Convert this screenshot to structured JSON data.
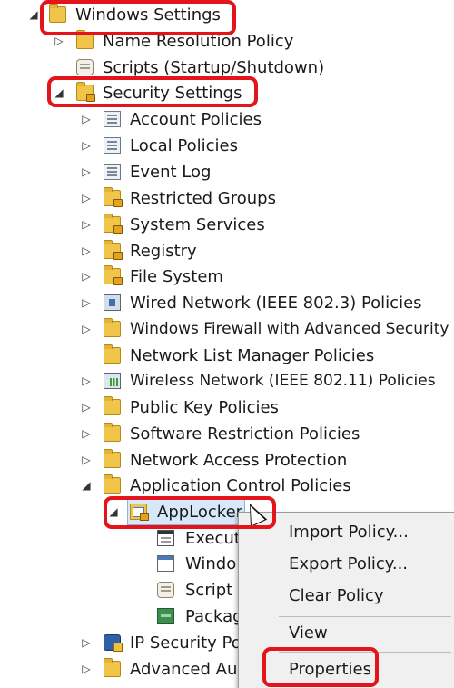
{
  "tree": [
    {
      "label": "Windows Settings",
      "expander": "◢",
      "icon": "folder-icon"
    },
    {
      "label": "Name Resolution Policy",
      "expander": "▷",
      "icon": "folder-icon"
    },
    {
      "label": "Scripts (Startup/Shutdown)",
      "expander": "",
      "icon": "scripts-icon"
    },
    {
      "label": "Security Settings",
      "expander": "◢",
      "icon": "security-settings-icon"
    },
    {
      "label": "Account Policies",
      "expander": "▷",
      "icon": "account-policies-icon"
    },
    {
      "label": "Local Policies",
      "expander": "▷",
      "icon": "local-policies-icon"
    },
    {
      "label": "Event Log",
      "expander": "▷",
      "icon": "event-log-icon"
    },
    {
      "label": "Restricted Groups",
      "expander": "▷",
      "icon": "locked-folder-icon"
    },
    {
      "label": "System Services",
      "expander": "▷",
      "icon": "locked-folder-icon"
    },
    {
      "label": "Registry",
      "expander": "▷",
      "icon": "locked-folder-icon"
    },
    {
      "label": "File System",
      "expander": "▷",
      "icon": "locked-folder-icon"
    },
    {
      "label": "Wired Network (IEEE 802.3) Policies",
      "expander": "▷",
      "icon": "wired-network-icon"
    },
    {
      "label": "Windows Firewall with Advanced Security",
      "expander": "▷",
      "icon": "folder-icon"
    },
    {
      "label": "Network List Manager Policies",
      "expander": "",
      "icon": "folder-icon"
    },
    {
      "label": "Wireless Network (IEEE 802.11) Policies",
      "expander": "▷",
      "icon": "wireless-network-icon"
    },
    {
      "label": "Public Key Policies",
      "expander": "▷",
      "icon": "folder-icon"
    },
    {
      "label": "Software Restriction Policies",
      "expander": "▷",
      "icon": "folder-icon"
    },
    {
      "label": "Network Access Protection",
      "expander": "▷",
      "icon": "folder-icon"
    },
    {
      "label": "Application Control Policies",
      "expander": "◢",
      "icon": "folder-icon"
    },
    {
      "label": "AppLocker",
      "expander": "◢",
      "icon": "applocker-icon"
    },
    {
      "label": "Executa",
      "expander": "",
      "icon": "executable-rules-icon"
    },
    {
      "label": "Windo",
      "expander": "",
      "icon": "windows-installer-rules-icon"
    },
    {
      "label": "Script R",
      "expander": "",
      "icon": "script-rules-icon"
    },
    {
      "label": "Packag",
      "expander": "",
      "icon": "packaged-app-rules-icon"
    },
    {
      "label": "IP Security Pol",
      "expander": "▷",
      "icon": "ip-security-icon"
    },
    {
      "label": "Advanced Aud",
      "expander": "▷",
      "icon": "folder-icon"
    }
  ],
  "context_menu": {
    "import_policy": "Import Policy...",
    "export_policy": "Export Policy...",
    "clear_policy": "Clear Policy",
    "view": "View",
    "properties": "Properties"
  },
  "highlight_color": "#e3141b"
}
